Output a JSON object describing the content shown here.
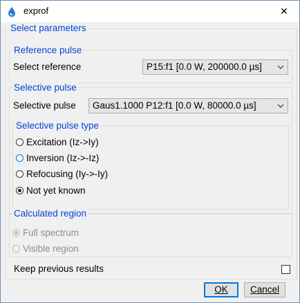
{
  "window": {
    "title": "exprof",
    "close_symbol": "✕"
  },
  "select_parameters": {
    "legend": "Select parameters"
  },
  "reference_pulse": {
    "legend": "Reference pulse",
    "label": "Select reference",
    "value": "P15:f1 [0.0 W, 200000.0 µs]"
  },
  "selective_pulse": {
    "legend": "Selective pulse",
    "label": "Selective pulse",
    "value": "Gaus1.1000  P12:f1 [0.0 W, 80000.0 µs]"
  },
  "pulse_type": {
    "legend": "Selective pulse type",
    "options": [
      "Excitation (Iz->Iy)",
      "Inversion (Iz->-Iz)",
      "Refocusing (Iy->-Iy)",
      "Not yet known"
    ],
    "selected": "Not yet known"
  },
  "calculated_region": {
    "legend": "Calculated region",
    "options": [
      "Full spectrum",
      "Visible region"
    ],
    "selected": "Full spectrum"
  },
  "keep_previous": {
    "label": "Keep previous results",
    "checked": false
  },
  "buttons": {
    "ok": "OK",
    "cancel": "Cancel"
  }
}
